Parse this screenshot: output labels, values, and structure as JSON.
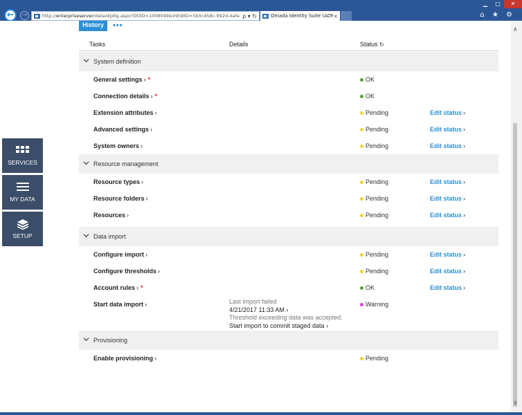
{
  "browser": {
    "url_prefix": "http://",
    "url_host": "enterpriseserver",
    "url_rest": "/dataobjdlg.aspx?DOID=1008049&VIEWID=5b0c458c-992d-4afe-b6ec-",
    "addr_controls": "ρ ▾ ↻",
    "tab_title": "Omada Identity Suite (ADM...",
    "tab_close": "×",
    "back_glyph": "←",
    "forward_glyph": "→",
    "right_icons": "⌂ ★ ⚙",
    "window_controls": {
      "minimize": "▁",
      "maximize": "□",
      "close": "✕"
    }
  },
  "tabs": {
    "active": "History",
    "more": "•••"
  },
  "table": {
    "headers": {
      "tasks": "Tasks",
      "details": "Details",
      "status": "Status",
      "status_icon": "↻"
    },
    "groups": [
      {
        "label": "System definition",
        "rows": [
          {
            "task": "General settings",
            "arrow": "›",
            "required": "*",
            "status": "OK",
            "status_color": "#5aa02c",
            "action": ""
          },
          {
            "task": "Connection details",
            "arrow": "›",
            "required": "*",
            "status": "OK",
            "status_color": "#5aa02c",
            "action": ""
          },
          {
            "task": "Extension attributes",
            "arrow": "›",
            "required": "",
            "status": "Pending",
            "status_color": "#f2d33b",
            "action": "Edit status",
            "action_arrow": "›"
          },
          {
            "task": "Advanced settings",
            "arrow": "›",
            "required": "",
            "status": "Pending",
            "status_color": "#f2d33b",
            "action": "Edit status",
            "action_arrow": "›"
          },
          {
            "task": "System owners",
            "arrow": "›",
            "required": "",
            "status": "Pending",
            "status_color": "#f2d33b",
            "action": "Edit status",
            "action_arrow": "›"
          }
        ]
      },
      {
        "label": "Resource management",
        "rows": [
          {
            "task": "Resource types",
            "arrow": "›",
            "required": "",
            "status": "Pending",
            "status_color": "#f2d33b",
            "action": "Edit status",
            "action_arrow": "›"
          },
          {
            "task": "Resource folders",
            "arrow": "›",
            "required": "",
            "status": "Pending",
            "status_color": "#f2d33b",
            "action": "Edit status",
            "action_arrow": "›"
          },
          {
            "task": "Resources",
            "arrow": "›",
            "required": "",
            "status": "Pending",
            "status_color": "#f2d33b",
            "action": "Edit status",
            "action_arrow": "›"
          }
        ]
      },
      {
        "label": "Data import",
        "rows": [
          {
            "task": "Configure import",
            "arrow": "›",
            "required": "",
            "status": "Pending",
            "status_color": "#f2d33b",
            "action": "Edit status",
            "action_arrow": "›"
          },
          {
            "task": "Configure thresholds",
            "arrow": "›",
            "required": "",
            "status": "Pending",
            "status_color": "#f2d33b",
            "action": "Edit status",
            "action_arrow": "›"
          },
          {
            "task": "Account rules",
            "arrow": "›",
            "required": "*",
            "status": "OK",
            "status_color": "#5aa02c",
            "action": "Edit status",
            "action_arrow": "›"
          },
          {
            "task": "Start data import",
            "arrow": "›",
            "required": "",
            "status": "Warning",
            "status_color": "#e23fe0",
            "action": "",
            "details": {
              "line1": "Last import failed",
              "line2": "4/21/2017 11:33 AM",
              "line2_arrow": "›",
              "line3": "Threshold exceeding data was accepted.",
              "line4": "Start import to commit staged data",
              "line4_arrow": "›"
            }
          }
        ]
      },
      {
        "label": "Provisioning",
        "rows": [
          {
            "task": "Enable provisioning",
            "arrow": "›",
            "required": "",
            "status": "Pending",
            "status_color": "#f2d33b",
            "action": ""
          }
        ]
      }
    ]
  },
  "sidenav": {
    "services": "SERVICES",
    "my_data": "MY DATA",
    "setup": "SETUP"
  },
  "scrollbar": {
    "up": "∧",
    "down": "∨"
  },
  "colors": {
    "accent": "#2b8fd6",
    "chrome": "#2b5797",
    "sidenav": "#3b4d68",
    "ok": "#5aa02c",
    "pending": "#f2d33b",
    "warning": "#e23fe0"
  }
}
